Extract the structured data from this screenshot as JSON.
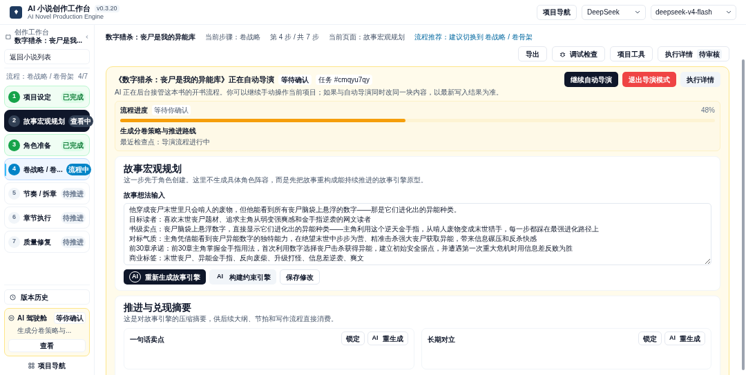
{
  "app": {
    "title": "AI 小说创作工作台",
    "version": "v0.3.20",
    "subtitle": "AI Novel Production Engine"
  },
  "header": {
    "nav_button": "项目导航",
    "provider": "DeepSeek",
    "model": "deepseek-v4-flash"
  },
  "sidebar": {
    "eyebrow": "创作工作台",
    "project": "数字猎杀：丧尸是我...",
    "back": "返回小说列表",
    "flow_label": "流程：卷战略 / 卷骨架",
    "flow_count": "4/7",
    "steps": [
      {
        "num": "1",
        "label": "项目设定",
        "badge": "已完成",
        "kind": "done",
        "selected": false
      },
      {
        "num": "2",
        "label": "故事宏观规划",
        "badge": "查看中",
        "kind": "viewing",
        "selected": true
      },
      {
        "num": "3",
        "label": "角色准备",
        "badge": "已完成",
        "kind": "done",
        "selected": false
      },
      {
        "num": "4",
        "label": "卷战略 / 卷...",
        "badge": "流程中",
        "kind": "active",
        "selected": false
      },
      {
        "num": "5",
        "label": "节奏 / 拆章",
        "badge": "待推进",
        "kind": "pending",
        "selected": false
      },
      {
        "num": "6",
        "label": "章节执行",
        "badge": "待推进",
        "kind": "pending",
        "selected": false
      },
      {
        "num": "7",
        "label": "质量修复",
        "badge": "待推进",
        "kind": "pending",
        "selected": false
      }
    ],
    "history": "版本历史",
    "copilot": {
      "title": "AI 驾驶舱",
      "badge": "等你确认",
      "desc": "生成分卷策略与...",
      "button": "查看"
    },
    "footer_nav": "项目导航"
  },
  "breadcrumb": {
    "project": "数字猎杀：丧尸是我的异能库",
    "step": "当前步骤：卷战略",
    "position": "第 4 步 / 共 7 步",
    "page": "当前页面：故事宏观规划",
    "recommend": "流程推荐：建议切换到 卷战略 / 卷骨架"
  },
  "toolbar": [
    {
      "label": "导出"
    },
    {
      "label": "调试检查"
    },
    {
      "label": "项目工具"
    },
    {
      "label": "执行详情",
      "badge": "待审核"
    }
  ],
  "banner": {
    "title": "《数字猎杀：丧尸是我的异能库》正在自动导演",
    "status": "等待确认",
    "task": "任务 #cmqyu7qy",
    "desc": "AI 正在后台接管这本书的开书流程。你可以继续手动操作当前项目；如果与自动导演同时改同一块内容，以最新写入结果为准。",
    "buttons": [
      {
        "label": "继续自动导演",
        "kind": "primary"
      },
      {
        "label": "退出导演模式",
        "kind": "danger"
      },
      {
        "label": "执行详情",
        "kind": "ghost"
      }
    ],
    "progress": {
      "title": "流程进度",
      "status": "等待你确认",
      "level": 0.48,
      "percent": "48%",
      "stage": "生成分卷策略与推进路线",
      "checkpoint": "最近检查点：导演流程进行中"
    }
  },
  "planning": {
    "title": "故事宏观规划",
    "desc": "这一步先于角色创建。这里不生成具体角色阵容，而是先把故事重构成能持续推进的故事引擎原型。",
    "input_label": "故事想法输入",
    "input_lines": [
      "他穿成丧尸末世里只会啃人的废物，但他能看到所有丧尸脑袋上悬浮的数字——那是它们进化出的异能种类。",
      "目标读者：喜欢末世丧尸题材、追求主角从弱变强爽感和金手指逆袭的网文读者",
      "书级卖点：丧尸脑袋上悬浮数字，直接显示它们进化出的异能种类——主角利用这个逆天金手指，从啃人废物变成末世猎手，每一步都踩在最强进化路径上",
      "对标气质：主角凭借能看到丧尸异能数字的独特能力，在绝望末世中步步为营、精准击杀强大丧尸获取异能，带来信息碾压和反杀快感",
      "前30章承诺：前30章主角掌握金手指用法，首次利用数字选择丧尸击杀获得异能，建立初始安全据点，并遭遇第一次重大危机时用信息差反败为胜",
      "商业标签：末世丧尸、异能金手指、反向废柴、升级打怪、信息差逆袭、爽文"
    ],
    "actions": [
      {
        "label": "重新生成故事引擎",
        "ai": "AI",
        "kind": "primary"
      },
      {
        "label": "构建约束引擎",
        "ai": "AI",
        "kind": "ghost"
      },
      {
        "label": "保存修改",
        "kind": "outline"
      }
    ]
  },
  "summary": {
    "title": "推进与兑现摘要",
    "desc": "这是对故事引擎的压缩摘要，供后续大纲、节拍和写作流程直接消费。",
    "fields": [
      {
        "label": "一句话卖点",
        "lock": "锁定",
        "ai": "AI",
        "regen": "重生成"
      },
      {
        "label": "长期对立",
        "lock": "锁定",
        "ai": "AI",
        "regen": "重生成"
      }
    ]
  }
}
